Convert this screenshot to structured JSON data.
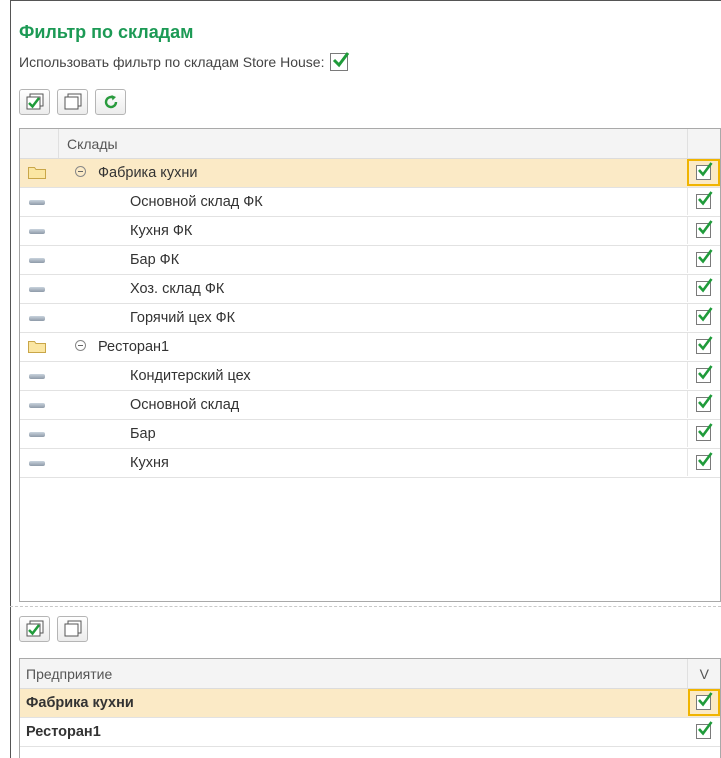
{
  "title": "Фильтр по складам",
  "filter": {
    "label": "Использовать фильтр по складам Store House:",
    "checked": true
  },
  "warehouses": {
    "column_header": "Склады",
    "rows": [
      {
        "label": "Фабрика кухни",
        "type": "group",
        "checked": true,
        "selected": true
      },
      {
        "label": "Основной склад ФК",
        "type": "item",
        "checked": true
      },
      {
        "label": "Кухня ФК",
        "type": "item",
        "checked": true
      },
      {
        "label": "Бар ФК",
        "type": "item",
        "checked": true
      },
      {
        "label": "Хоз. склад ФК",
        "type": "item",
        "checked": true
      },
      {
        "label": "Горячий цех ФК",
        "type": "item",
        "checked": true
      },
      {
        "label": "Ресторан1",
        "type": "group",
        "checked": true
      },
      {
        "label": "Кондитерский цех",
        "type": "item",
        "checked": true
      },
      {
        "label": "Основной склад",
        "type": "item",
        "checked": true
      },
      {
        "label": "Бар",
        "type": "item",
        "checked": true
      },
      {
        "label": "Кухня",
        "type": "item",
        "checked": true
      }
    ]
  },
  "enterprises": {
    "column_header": "Предприятие",
    "check_header": "V",
    "rows": [
      {
        "label": "Фабрика кухни",
        "checked": true,
        "selected": true
      },
      {
        "label": "Ресторан1",
        "checked": true
      }
    ]
  },
  "colors": {
    "title": "#1c9a55",
    "selection": "#fbeac6",
    "check": "#1f9b3a"
  },
  "icons": [
    "check-all-icon",
    "uncheck-all-icon",
    "refresh-icon",
    "folder-icon",
    "item-icon",
    "collapse-icon",
    "checkmark-icon"
  ]
}
